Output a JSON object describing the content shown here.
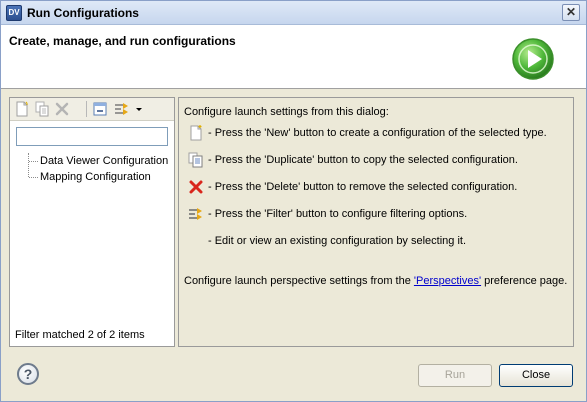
{
  "window": {
    "title": "Run Configurations",
    "icon_text": "DV",
    "close_glyph": "✕"
  },
  "banner": {
    "title": "Create, manage, and run configurations"
  },
  "left": {
    "filter_value": "",
    "tree": [
      "Data Viewer Configuration",
      "Mapping Configuration"
    ],
    "status": "Filter matched 2 of 2 items"
  },
  "right": {
    "heading": "Configure launch settings from this dialog:",
    "rows": [
      "- Press the 'New' button to create a configuration of the selected type.",
      "- Press the 'Duplicate' button to copy the selected configuration.",
      "- Press the 'Delete' button to remove the selected configuration.",
      "- Press the 'Filter' button to configure filtering options.",
      "- Edit or view an existing configuration by selecting it."
    ],
    "footer_prefix": "Configure launch perspective settings from the ",
    "footer_link": "'Perspectives'",
    "footer_suffix": " preference page."
  },
  "buttons": {
    "run": "Run",
    "close": "Close",
    "help": "?"
  },
  "colors": {
    "accent": "#3ca63c",
    "delete": "#d9261c",
    "link": "#0000cc"
  }
}
